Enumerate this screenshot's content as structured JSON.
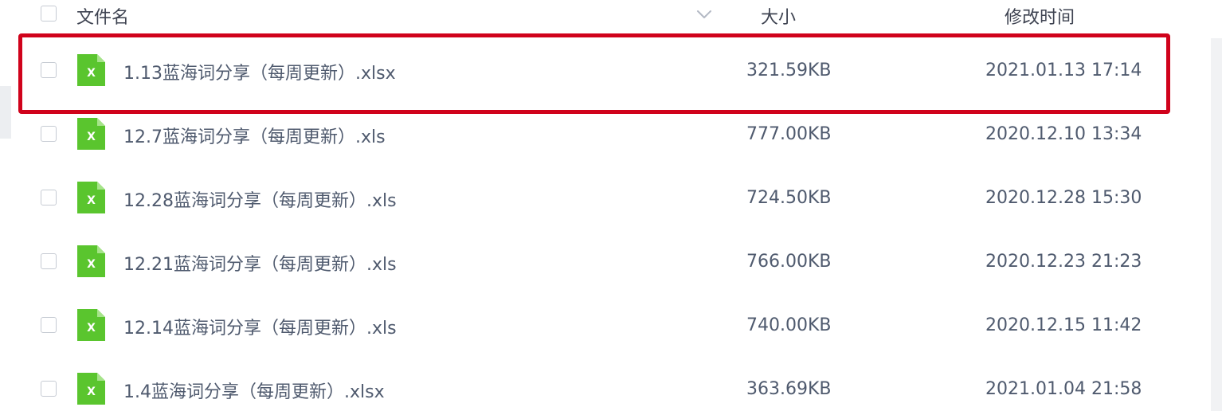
{
  "header": {
    "col_name": "文件名",
    "col_size": "大小",
    "col_mtime": "修改时间",
    "sort_icon": "chevron-down-icon"
  },
  "files": [
    {
      "name": "1.13蓝海词分享（每周更新）.xlsx",
      "size": "321.59KB",
      "mtime": "2021.01.13 17:14",
      "icon": "excel-file-icon",
      "highlighted": true
    },
    {
      "name": "12.7蓝海词分享（每周更新）.xls",
      "size": "777.00KB",
      "mtime": "2020.12.10 13:34",
      "icon": "excel-file-icon"
    },
    {
      "name": "12.28蓝海词分享（每周更新）.xls",
      "size": "724.50KB",
      "mtime": "2020.12.28 15:30",
      "icon": "excel-file-icon"
    },
    {
      "name": "12.21蓝海词分享（每周更新）.xls",
      "size": "766.00KB",
      "mtime": "2020.12.23 21:23",
      "icon": "excel-file-icon"
    },
    {
      "name": "12.14蓝海词分享（每周更新）.xls",
      "size": "740.00KB",
      "mtime": "2020.12.15 11:42",
      "icon": "excel-file-icon"
    },
    {
      "name": "1.4蓝海词分享（每周更新）.xlsx",
      "size": "363.69KB",
      "mtime": "2021.01.04 21:58",
      "icon": "excel-file-icon"
    }
  ],
  "colors": {
    "excel_icon": "#5ac52e",
    "highlight_border": "#d0021b",
    "text": "#4f5a6e"
  }
}
